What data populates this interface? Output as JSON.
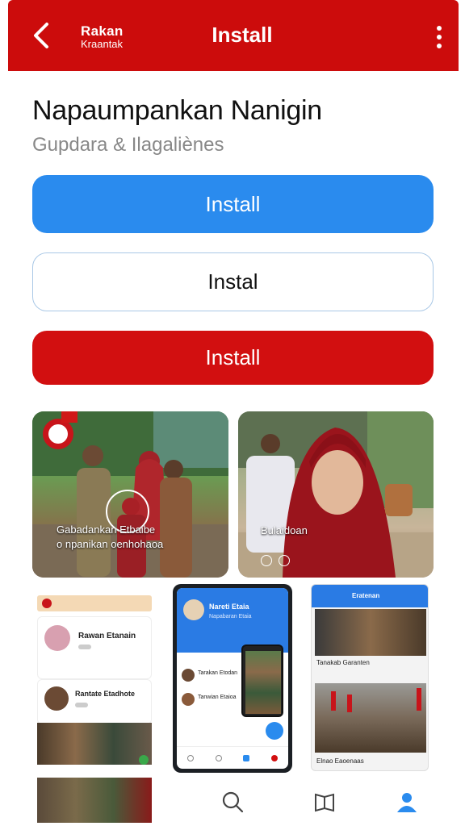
{
  "app_bar": {
    "brand_line1": "Rakan",
    "brand_line2": "Kraantak",
    "title": "Install",
    "bg_color": "#cc0c0c"
  },
  "header": {
    "title": "Napaumpankan Nanigin",
    "subtitle": "Gupdara & Ilagaliènes"
  },
  "buttons": {
    "primary_label": "Install",
    "outline_label": "Instal",
    "red_label": "Install",
    "primary_color": "#2a8bee",
    "red_color": "#d20f10"
  },
  "media": {
    "tile1_caption_line1": "Gabadankan Etbaibe",
    "tile1_caption_line2": "o npanikan oenhohaoa",
    "tile2_caption": "Bulaidoan"
  },
  "shot_left": {
    "row1_name": "Rawan Etanain",
    "row2_name": "Rantate Etadhote"
  },
  "shot_mid": {
    "header_title": "Nareti Etaia",
    "header_sub": "Napabaran Etaia",
    "row1": "Tarakan Etodan",
    "row2": "Tanwian Etaioa"
  },
  "shot_right": {
    "header_title": "Eratenan",
    "row1": "Tanakab Garanten",
    "row2": "Elnao Eaoenaas"
  },
  "bottom_nav": {
    "items": [
      "search-icon",
      "book-icon",
      "profile-icon"
    ],
    "active_color": "#2a8bee"
  }
}
